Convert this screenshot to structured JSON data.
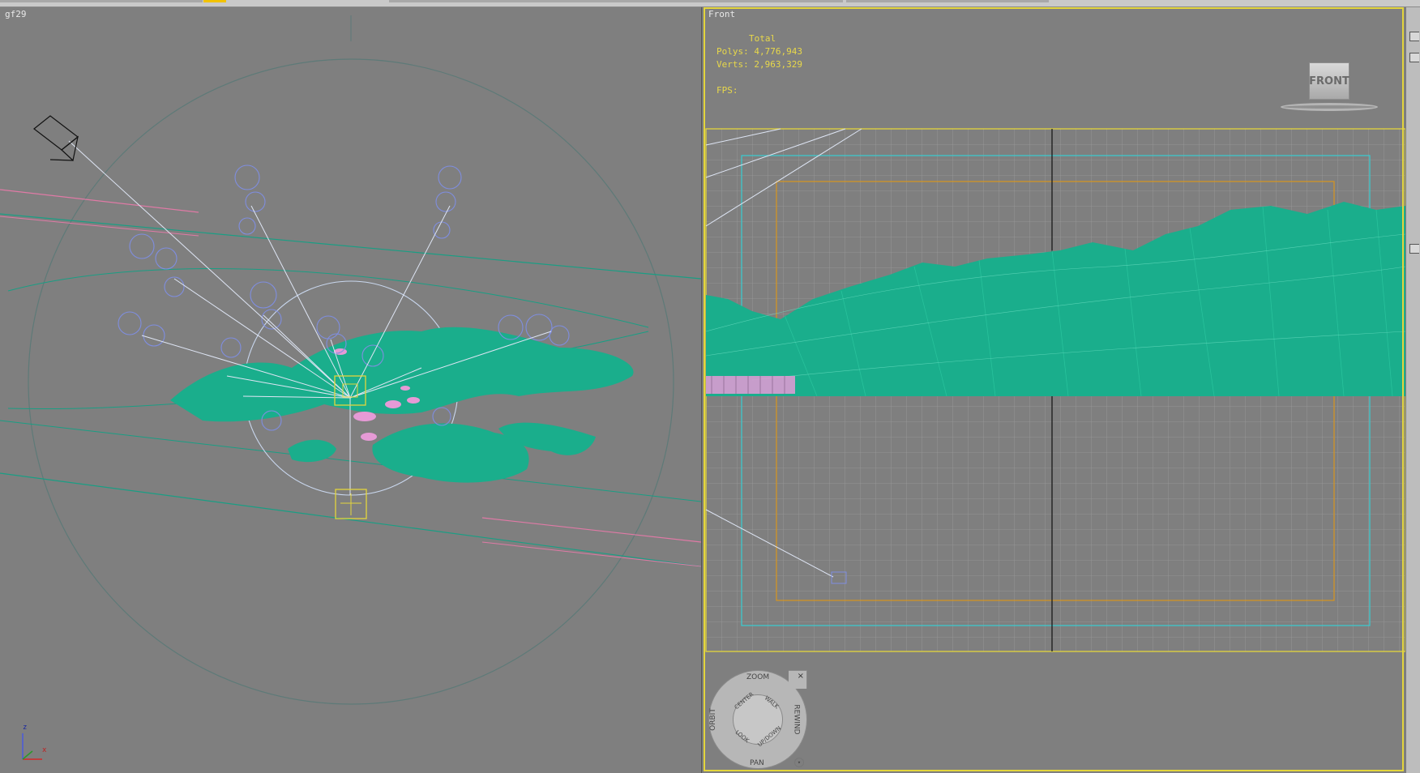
{
  "left_viewport": {
    "label": "gf29"
  },
  "right_viewport": {
    "label": "Front",
    "stats": {
      "total_label": "Total",
      "polys_label": "Polys:",
      "polys_value": "4,776,943",
      "verts_label": "Verts:",
      "verts_value": "2,963,329",
      "fps_label": "FPS:"
    },
    "viewcube_label": "FRONT"
  },
  "steering_wheel": {
    "zoom": "ZOOM",
    "orbit": "ORBIT",
    "rewind": "REWIND",
    "pan": "PAN",
    "center": "CENTER",
    "walk": "WALK",
    "look": "LOOK",
    "updown": "UP/DOWN",
    "close": "×",
    "menu": "▾"
  },
  "axis": {
    "z": "z",
    "x": "x"
  },
  "colors": {
    "terrain": "#1aae8c",
    "selection": "#e3d53c",
    "grid": "#9a9a9a",
    "spline_pink": "#e07aa6",
    "light_blue": "#7f8ee0"
  }
}
